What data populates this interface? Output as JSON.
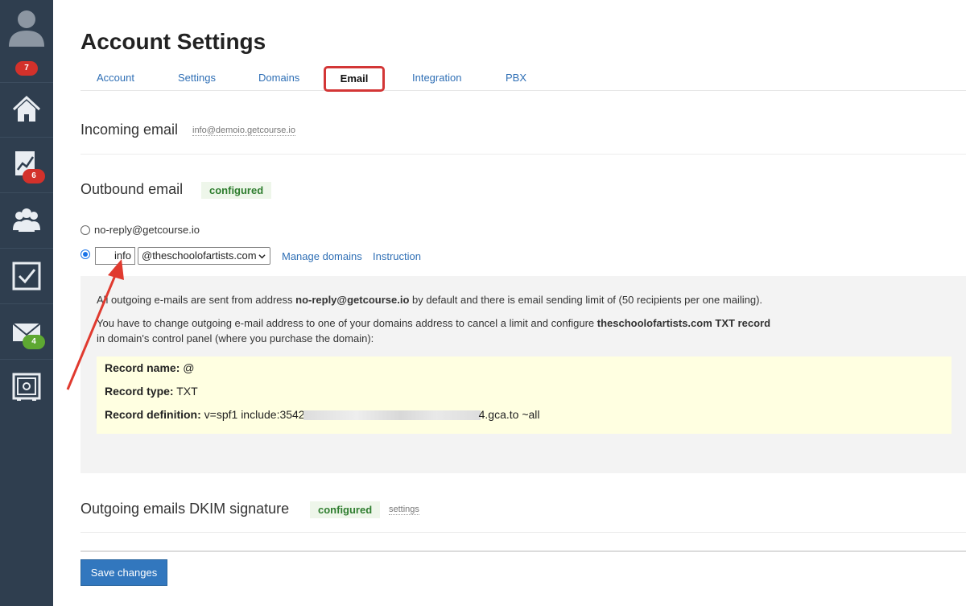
{
  "sidebar": {
    "badges": {
      "profile": "7",
      "stats": "6",
      "mail": "4"
    },
    "icons": [
      "user-icon",
      "home-icon",
      "chart-icon",
      "users-icon",
      "tasks-icon",
      "mail-icon",
      "safe-icon"
    ]
  },
  "page": {
    "title": "Account Settings"
  },
  "tabs": [
    {
      "label": "Account"
    },
    {
      "label": "Settings"
    },
    {
      "label": "Domains"
    },
    {
      "label": "Email",
      "active": true
    },
    {
      "label": "Integration"
    },
    {
      "label": "PBX"
    }
  ],
  "incoming": {
    "title": "Incoming email",
    "address": "info@demoio.getcourse.io"
  },
  "outbound": {
    "title": "Outbound email",
    "status": "configured",
    "option_default": "no-reply@getcourse.io",
    "local_part": "info",
    "domain_selected": "@theschoolofartists.com",
    "manage_domains": "Manage domains",
    "instruction": "Instruction"
  },
  "info": {
    "line1_pre": "All outgoing e-mails are sent from address ",
    "line1_bold": "no-reply@getcourse.io",
    "line1_post": " by default and there is email sending limit of (50 recipients per one mailing).",
    "line2_pre": "You have to change outgoing e-mail address to one of your domains address to cancel a limit   and configure ",
    "line2_bold": "theschoolofartists.com TXT record",
    "line3": "in domain's control panel (where you purchase the domain):",
    "record_name_label": "Record name:",
    "record_name_value": " @",
    "record_type_label": "Record type:",
    "record_type_value": " TXT",
    "record_def_label": "Record definition:",
    "record_def_pre": " v=spf1 include:3542",
    "record_def_post": "4.gca.to ~all"
  },
  "dkim": {
    "title": "Outgoing emails DKIM signature",
    "status": "configured",
    "settings": "settings"
  },
  "actions": {
    "save": "Save changes"
  },
  "colors": {
    "sidebar": "#2f3e4f",
    "link": "#2f6fb5",
    "highlight": "#d33636",
    "configured": "#2e7d2e",
    "button": "#3277be"
  }
}
